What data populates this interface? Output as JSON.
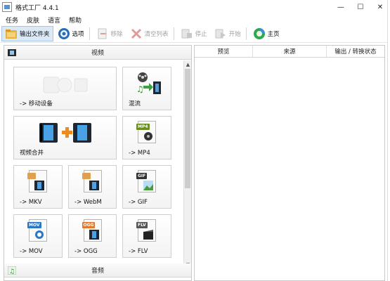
{
  "window": {
    "title": "格式工厂 4.4.1",
    "minimize": "—",
    "maximize": "☐",
    "close": "✕"
  },
  "menu": [
    "任务",
    "皮肤",
    "语言",
    "帮助"
  ],
  "toolbar": {
    "output_folder": "输出文件夹",
    "options": "选项",
    "remove": "移除",
    "clear_list": "清空列表",
    "stop": "停止",
    "start": "开始",
    "home": "主页"
  },
  "categories": {
    "video": "视频",
    "audio": "音频"
  },
  "tiles": {
    "mobile": "-> 移动设备",
    "mix": "混流",
    "merge": "视频合并",
    "mp4": "-> MP4",
    "mkv": "-> MKV",
    "webm": "-> WebM",
    "gif": "-> GIF",
    "mov": "-> MOV",
    "ogg": "-> OGG",
    "flv": "-> FLV"
  },
  "badges": {
    "mp4": "MP4",
    "gif": "GIF",
    "mov": "MOV",
    "ogg": "OGG",
    "flv": "FLV"
  },
  "table": {
    "col_preview": "预览",
    "col_source": "来源",
    "col_status": "输出 / 转换状态"
  },
  "colors": {
    "accent": "#2a78c3",
    "toolbar_active": "#dbe8f6",
    "green_home": "#2fa84a"
  }
}
